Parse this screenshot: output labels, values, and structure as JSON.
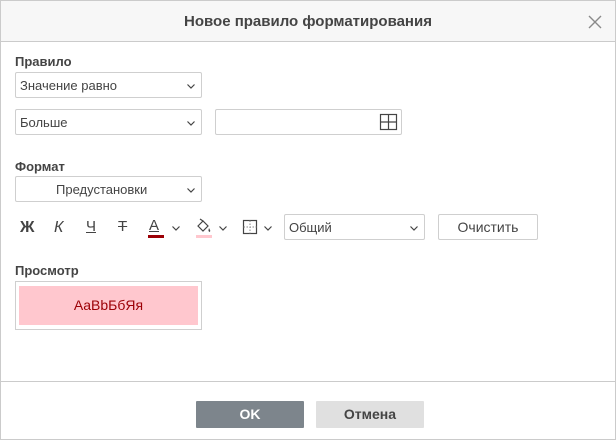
{
  "dialog": {
    "title": "Новое правило форматирования"
  },
  "rule": {
    "label": "Правило",
    "type_value": "Значение равно",
    "condition_value": "Больше",
    "input_value": ""
  },
  "format": {
    "label": "Формат",
    "presets_value": "Предустановки",
    "bold_label": "Ж",
    "italic_label": "К",
    "underline_label": "Ч",
    "strike_label": "Т",
    "font_color_label": "А",
    "font_color": "#9c0006",
    "fill_color": "#ffc7ce",
    "number_format_value": "Общий",
    "clear_label": "Очистить"
  },
  "preview": {
    "label": "Просмотр",
    "sample_text": "AaBbБбЯя"
  },
  "footer": {
    "ok_label": "OK",
    "cancel_label": "Отмена"
  }
}
